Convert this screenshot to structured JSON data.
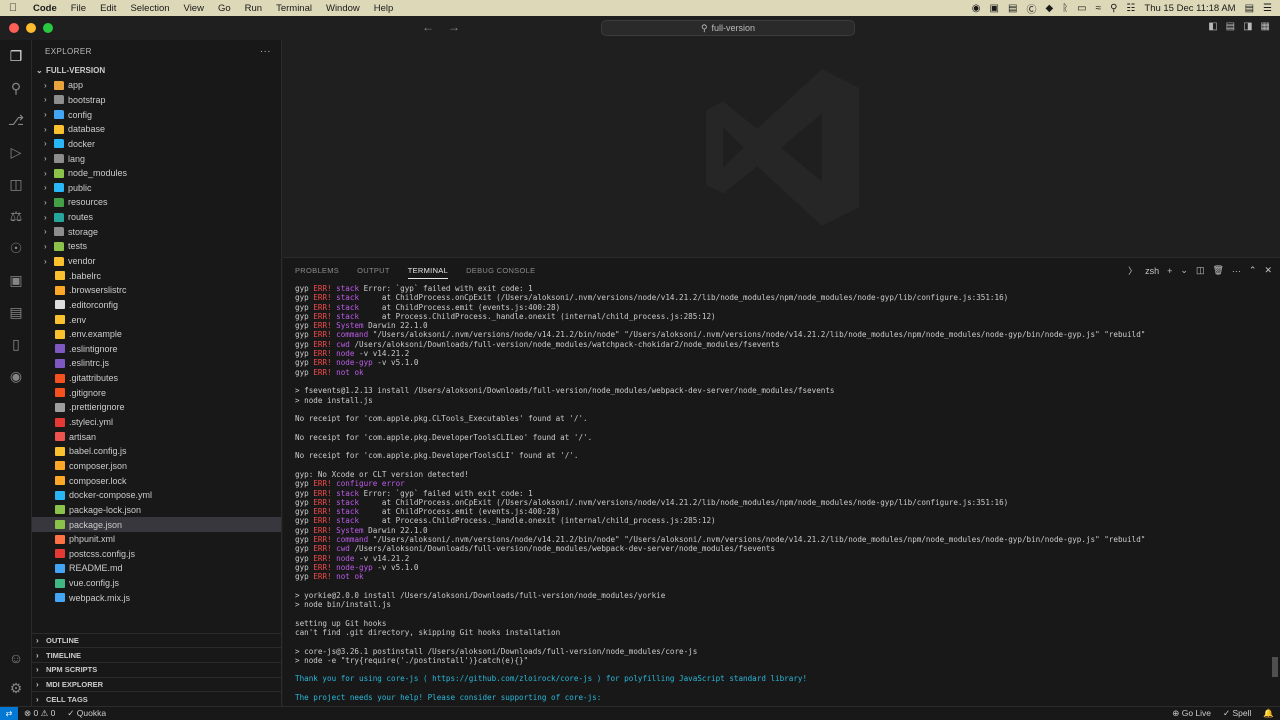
{
  "menubar": {
    "app": "Code",
    "items": [
      "File",
      "Edit",
      "Selection",
      "View",
      "Go",
      "Run",
      "Terminal",
      "Window",
      "Help"
    ],
    "clock": "Thu 15 Dec  11:18 AM"
  },
  "titlebar": {
    "command_center": "full-version"
  },
  "explorer": {
    "header": "EXPLORER",
    "root": "FULL-VERSION",
    "items": [
      {
        "label": "app",
        "type": "folder",
        "color": "#e8a33d"
      },
      {
        "label": "bootstrap",
        "type": "folder",
        "color": "#8d8d8d"
      },
      {
        "label": "config",
        "type": "folder",
        "color": "#42a5f5"
      },
      {
        "label": "database",
        "type": "folder",
        "color": "#fbc02d"
      },
      {
        "label": "docker",
        "type": "folder",
        "color": "#29b6f6"
      },
      {
        "label": "lang",
        "type": "folder",
        "color": "#8d8d8d"
      },
      {
        "label": "node_modules",
        "type": "folder",
        "color": "#8bc34a"
      },
      {
        "label": "public",
        "type": "folder",
        "color": "#29b6f6"
      },
      {
        "label": "resources",
        "type": "folder",
        "color": "#43a047"
      },
      {
        "label": "routes",
        "type": "folder",
        "color": "#26a69a"
      },
      {
        "label": "storage",
        "type": "folder",
        "color": "#8d8d8d"
      },
      {
        "label": "tests",
        "type": "folder",
        "color": "#8bc34a"
      },
      {
        "label": "vendor",
        "type": "folder",
        "color": "#fbc02d"
      },
      {
        "label": ".babelrc",
        "type": "file",
        "color": "#fbc02d"
      },
      {
        "label": ".browserslistrc",
        "type": "file",
        "color": "#ffa726"
      },
      {
        "label": ".editorconfig",
        "type": "file",
        "color": "#dddddd"
      },
      {
        "label": ".env",
        "type": "file",
        "color": "#fbc02d"
      },
      {
        "label": ".env.example",
        "type": "file",
        "color": "#fbc02d"
      },
      {
        "label": ".eslintignore",
        "type": "file",
        "color": "#7e57c2"
      },
      {
        "label": ".eslintrc.js",
        "type": "file",
        "color": "#7e57c2"
      },
      {
        "label": ".gitattributes",
        "type": "file",
        "color": "#f4511e"
      },
      {
        "label": ".gitignore",
        "type": "file",
        "color": "#f4511e"
      },
      {
        "label": ".prettierignore",
        "type": "file",
        "color": "#9e9e9e"
      },
      {
        "label": ".styleci.yml",
        "type": "file",
        "color": "#e53935"
      },
      {
        "label": "artisan",
        "type": "file",
        "color": "#ef5350"
      },
      {
        "label": "babel.config.js",
        "type": "file",
        "color": "#fbc02d"
      },
      {
        "label": "composer.json",
        "type": "file",
        "color": "#ffa726"
      },
      {
        "label": "composer.lock",
        "type": "file",
        "color": "#ffa726"
      },
      {
        "label": "docker-compose.yml",
        "type": "file",
        "color": "#29b6f6"
      },
      {
        "label": "package-lock.json",
        "type": "file",
        "color": "#8bc34a"
      },
      {
        "label": "package.json",
        "type": "file",
        "color": "#8bc34a",
        "selected": true
      },
      {
        "label": "phpunit.xml",
        "type": "file",
        "color": "#ff7043"
      },
      {
        "label": "postcss.config.js",
        "type": "file",
        "color": "#e53935"
      },
      {
        "label": "README.md",
        "type": "file",
        "color": "#42a5f5"
      },
      {
        "label": "vue.config.js",
        "type": "file",
        "color": "#41b883"
      },
      {
        "label": "webpack.mix.js",
        "type": "file",
        "color": "#42a5f5"
      }
    ],
    "sections": [
      "OUTLINE",
      "TIMELINE",
      "NPM SCRIPTS",
      "MDI EXPLORER",
      "CELL TAGS"
    ]
  },
  "panel": {
    "tabs": [
      "PROBLEMS",
      "OUTPUT",
      "TERMINAL",
      "DEBUG CONSOLE"
    ],
    "active_tab": "TERMINAL",
    "shell": "zsh",
    "terminal_lines": [
      "gyp ERR! stack Error: `gyp` failed with exit code: 1",
      "gyp ERR! stack     at ChildProcess.onCpExit (/Users/aloksoni/.nvm/versions/node/v14.21.2/lib/node_modules/npm/node_modules/node-gyp/lib/configure.js:351:16)",
      "gyp ERR! stack     at ChildProcess.emit (events.js:400:28)",
      "gyp ERR! stack     at Process.ChildProcess._handle.onexit (internal/child_process.js:285:12)",
      "gyp ERR! System Darwin 22.1.0",
      "gyp ERR! command \"/Users/aloksoni/.nvm/versions/node/v14.21.2/bin/node\" \"/Users/aloksoni/.nvm/versions/node/v14.21.2/lib/node_modules/npm/node_modules/node-gyp/bin/node-gyp.js\" \"rebuild\"",
      "gyp ERR! cwd /Users/aloksoni/Downloads/full-version/node_modules/watchpack-chokidar2/node_modules/fsevents",
      "gyp ERR! node -v v14.21.2",
      "gyp ERR! node-gyp -v v5.1.0",
      "gyp ERR! not ok",
      "",
      "> fsevents@1.2.13 install /Users/aloksoni/Downloads/full-version/node_modules/webpack-dev-server/node_modules/fsevents",
      "> node install.js",
      "",
      "No receipt for 'com.apple.pkg.CLTools_Executables' found at '/'.",
      "",
      "No receipt for 'com.apple.pkg.DeveloperToolsCLILeo' found at '/'.",
      "",
      "No receipt for 'com.apple.pkg.DeveloperToolsCLI' found at '/'.",
      "",
      "gyp: No Xcode or CLT version detected!",
      "gyp ERR! configure error",
      "gyp ERR! stack Error: `gyp` failed with exit code: 1",
      "gyp ERR! stack     at ChildProcess.onCpExit (/Users/aloksoni/.nvm/versions/node/v14.21.2/lib/node_modules/npm/node_modules/node-gyp/lib/configure.js:351:16)",
      "gyp ERR! stack     at ChildProcess.emit (events.js:400:28)",
      "gyp ERR! stack     at Process.ChildProcess._handle.onexit (internal/child_process.js:285:12)",
      "gyp ERR! System Darwin 22.1.0",
      "gyp ERR! command \"/Users/aloksoni/.nvm/versions/node/v14.21.2/bin/node\" \"/Users/aloksoni/.nvm/versions/node/v14.21.2/lib/node_modules/npm/node_modules/node-gyp/bin/node-gyp.js\" \"rebuild\"",
      "gyp ERR! cwd /Users/aloksoni/Downloads/full-version/node_modules/webpack-dev-server/node_modules/fsevents",
      "gyp ERR! node -v v14.21.2",
      "gyp ERR! node-gyp -v v5.1.0",
      "gyp ERR! not ok",
      "",
      "> yorkie@2.0.0 install /Users/aloksoni/Downloads/full-version/node_modules/yorkie",
      "> node bin/install.js",
      "",
      "setting up Git hooks",
      "can't find .git directory, skipping Git hooks installation",
      "",
      "> core-js@3.26.1 postinstall /Users/aloksoni/Downloads/full-version/node_modules/core-js",
      "> node -e \"try{require('./postinstall')}catch(e){}\"",
      "",
      "Thank you for using core-js ( https://github.com/zloirock/core-js ) for polyfilling JavaScript standard library!",
      "",
      "The project needs your help! Please consider supporting of core-js:"
    ]
  },
  "statusbar": {
    "errors": "0",
    "warnings": "0",
    "quokka": "Quokka",
    "golive": "Go Live",
    "spell": "Spell"
  }
}
